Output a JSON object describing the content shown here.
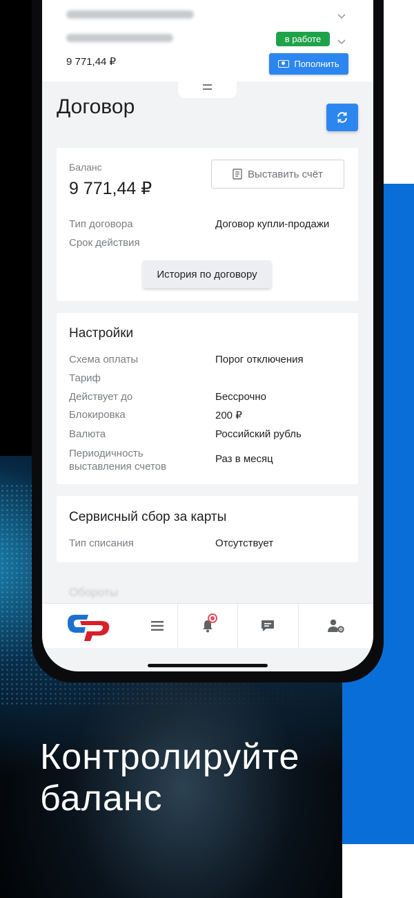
{
  "promo": {
    "tagline_line1": "Контролируйте",
    "tagline_line2": "баланс"
  },
  "contract_header": {
    "balance": "9 771,44 ₽",
    "status_badge": "в работе",
    "topup_button": "Пополнить",
    "topup_icon": "cash-icon",
    "colors": {
      "status": "#1fa34a",
      "accent": "#2c86f0"
    }
  },
  "page": {
    "title": "Договор",
    "refresh_icon": "refresh-icon"
  },
  "balance_card": {
    "balance_label": "Баланс",
    "balance_value": "9 771,44 ₽",
    "invoice_button": "Выставить счёт",
    "invoice_icon": "receipt-icon",
    "rows": [
      {
        "label": "Тип договора",
        "value": "Договор купли-продажи"
      },
      {
        "label": "Срок действия",
        "value": ""
      }
    ],
    "history_button": "История по договору"
  },
  "settings_card": {
    "title": "Настройки",
    "rows": [
      {
        "label": "Схема оплаты",
        "value": "Порог отключения"
      },
      {
        "label": "Тариф",
        "value": ""
      },
      {
        "label": "Действует до",
        "value": "Бессрочно"
      },
      {
        "label": "Блокировка",
        "value": "200 ₽"
      },
      {
        "label": "Валюта",
        "value": "Российский рубль"
      },
      {
        "label": "Периодичность выставления счетов",
        "value": "Раз в месяц"
      }
    ]
  },
  "service_fee_card": {
    "title": "Сервисный сбор за карты",
    "rows": [
      {
        "label": "Тип списания",
        "value": "Отсутствует"
      }
    ]
  },
  "next_section_title": "Обороты",
  "tabbar": {
    "items": [
      {
        "icon": "brand-logo"
      },
      {
        "icon": "menu-icon"
      },
      {
        "icon": "bell-icon",
        "has_notification": true
      },
      {
        "icon": "chat-icon"
      },
      {
        "icon": "user-settings-icon"
      }
    ]
  }
}
